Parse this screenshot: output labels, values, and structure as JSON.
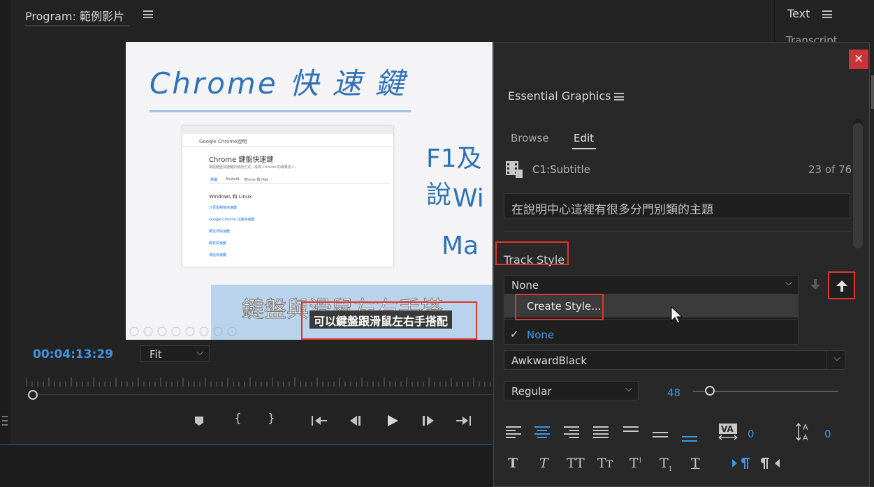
{
  "program": {
    "title": "Program: 範例影片",
    "timecode": "00:04:13:29",
    "fit": "Fit",
    "video": {
      "heading": "Chrome 快 速 鍵",
      "side_lines": [
        "F1及說",
        "Wi",
        "Ma"
      ],
      "browser_title": "Google Chrome說明",
      "page_heading": "Chrome 鍵盤快速鍵",
      "page_sub": "掌握鍵盤快捷鍵的使用方式，成為 Chrome 的專業達人。",
      "tabs": [
        "電腦",
        "Android",
        "iPhone 和 iPad"
      ],
      "section": "Windows 和 Linux",
      "links": [
        "分頁與視窗快速鍵",
        "Google Chrome 功能快速鍵",
        "網址列快速鍵",
        "網頁快速鍵",
        "滑鼠快速鍵"
      ],
      "bottom_hand": "鍵盤與滑鼠左右手搭",
      "subtitle": "可以鍵盤跟滑鼠左右手搭配"
    }
  },
  "text_panel": {
    "title": "Text",
    "tab": "Transcript"
  },
  "eg": {
    "title": "Essential Graphics",
    "close": "×",
    "tabs": {
      "browse": "Browse",
      "edit": "Edit"
    },
    "clip_name": "C1:Subtitle",
    "count": "23 of 76",
    "caption_text": "在說明中心這裡有很多分門別類的主題",
    "track_style_label": "Track Style",
    "track_style_value": "None",
    "menu": {
      "create": "Create Style...",
      "none": "None",
      "check": "✓"
    },
    "font": "AwkwardBlack",
    "weight": "Regular",
    "size": "48",
    "kerning": "0",
    "leading": "0"
  },
  "colors": {
    "accent": "#3f95e0",
    "highlight": "#e0352b",
    "close_bg": "#c8343a"
  }
}
